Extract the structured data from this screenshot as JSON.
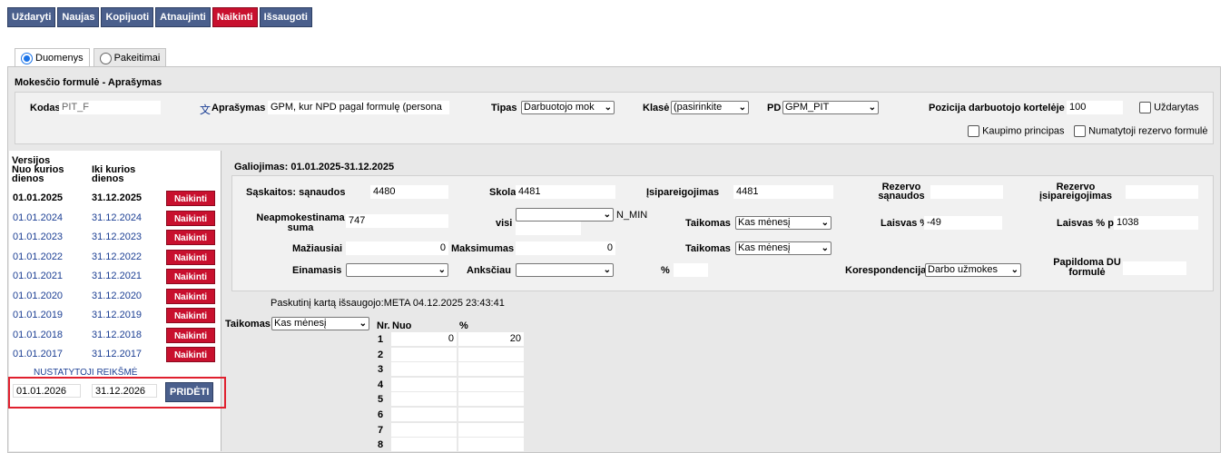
{
  "toolbar": {
    "close": "Uždaryti",
    "new": "Naujas",
    "copy": "Kopijuoti",
    "refresh": "Atnaujinti",
    "delete": "Naikinti",
    "save": "Išsaugoti"
  },
  "tabs": {
    "data": "Duomenys",
    "changes": "Pakeitimai"
  },
  "header": {
    "title": "Mokesčio formulė - Aprašymas",
    "code_label": "Kodas",
    "code_value": "PIT_F",
    "desc_label": "Aprašymas",
    "desc_value": "GPM, kur NPD pagal formulę (persona",
    "type_label": "Tipas",
    "type_value": "Darbuotojo mok",
    "class_label": "Klasė",
    "class_value": "(pasirinkite",
    "pd_label": "PD",
    "pd_value": "GPM_PIT",
    "pos_label": "Pozicija darbuotojo kortelėje",
    "pos_value": "100",
    "closed_label": "Uždarytas",
    "accrual_label": "Kaupimo principas",
    "reserve_label": "Numatytoji rezervo formulė"
  },
  "versions": {
    "title": "Versijos",
    "col_from": "Nuo kurios dienos",
    "col_to": "Iki kurios dienos",
    "delete_label": "Naikinti",
    "rows": [
      {
        "from": "01.01.2025",
        "to": "31.12.2025"
      },
      {
        "from": "01.01.2024",
        "to": "31.12.2024"
      },
      {
        "from": "01.01.2023",
        "to": "31.12.2023"
      },
      {
        "from": "01.01.2022",
        "to": "31.12.2022"
      },
      {
        "from": "01.01.2021",
        "to": "31.12.2021"
      },
      {
        "from": "01.01.2020",
        "to": "31.12.2020"
      },
      {
        "from": "01.01.2019",
        "to": "31.12.2019"
      },
      {
        "from": "01.01.2018",
        "to": "31.12.2018"
      },
      {
        "from": "01.01.2017",
        "to": "31.12.2017"
      }
    ],
    "defaults_link": "NUSTATYTOJI REIKŠMĖ",
    "new_from": "01.01.2026",
    "new_to": "31.12.2026",
    "add_label": "PRIDĖTI"
  },
  "validity": {
    "title": "Galiojimas: 01.01.2025-31.12.2025",
    "accounts_label": "Sąskaitos: sąnaudos",
    "accounts_value": "4480",
    "debt_label": "Skola",
    "debt_value": "4481",
    "liab_label": "Įsipareigojimas",
    "liab_value": "4481",
    "res_cost_label": "Rezervo sąnaudos",
    "res_cost_value": "",
    "res_liab_label": "Rezervo įsipareigojimas",
    "res_liab_value": "",
    "nontax_label": "Neapmokestinama suma",
    "nontax_value": "747",
    "visi_label": "visi",
    "visi_value": "",
    "nmin_label": "N_MIN",
    "applied_label": "Taikomas",
    "applied_value": "Kas mėnesį",
    "free_label": "Laisvas %",
    "free_value": "-49",
    "free_po_label": "Laisvas % po",
    "free_po_value": "1038",
    "less_label": "Mažiausiai",
    "less_value": "0",
    "max_label": "Maksimumas",
    "max_value": "0",
    "applied2_label": "Taikomas",
    "applied2_value": "Kas mėnesį",
    "current_label": "Einamasis",
    "current_value": "",
    "earlier_label": "Anksčiau",
    "earlier_value": "",
    "pct_label": "%",
    "pct_value": "",
    "corr_label": "Korespondencija",
    "corr_value": "Darbo užmokes",
    "extra_label": "Papildoma DU formulė",
    "extra_value": ""
  },
  "lastsaved": "Paskutinį kartą išsaugojo:META 04.12.2025 23:43:41",
  "rates": {
    "applied_label": "Taikomas",
    "applied_value": "Kas mėnesį",
    "col_nr": "Nr.",
    "col_from": "Nuo",
    "col_pct": "%",
    "rows": [
      {
        "nr": "1",
        "from": "0",
        "pct": "20"
      },
      {
        "nr": "2",
        "from": "",
        "pct": ""
      },
      {
        "nr": "3",
        "from": "",
        "pct": ""
      },
      {
        "nr": "4",
        "from": "",
        "pct": ""
      },
      {
        "nr": "5",
        "from": "",
        "pct": ""
      },
      {
        "nr": "6",
        "from": "",
        "pct": ""
      },
      {
        "nr": "7",
        "from": "",
        "pct": ""
      },
      {
        "nr": "8",
        "from": "",
        "pct": ""
      }
    ]
  },
  "colors": {
    "toolbar_blue": "#4a5f8c",
    "danger_red": "#c8102e",
    "link_blue": "#1c3f94",
    "highlight": "#e0202e"
  }
}
